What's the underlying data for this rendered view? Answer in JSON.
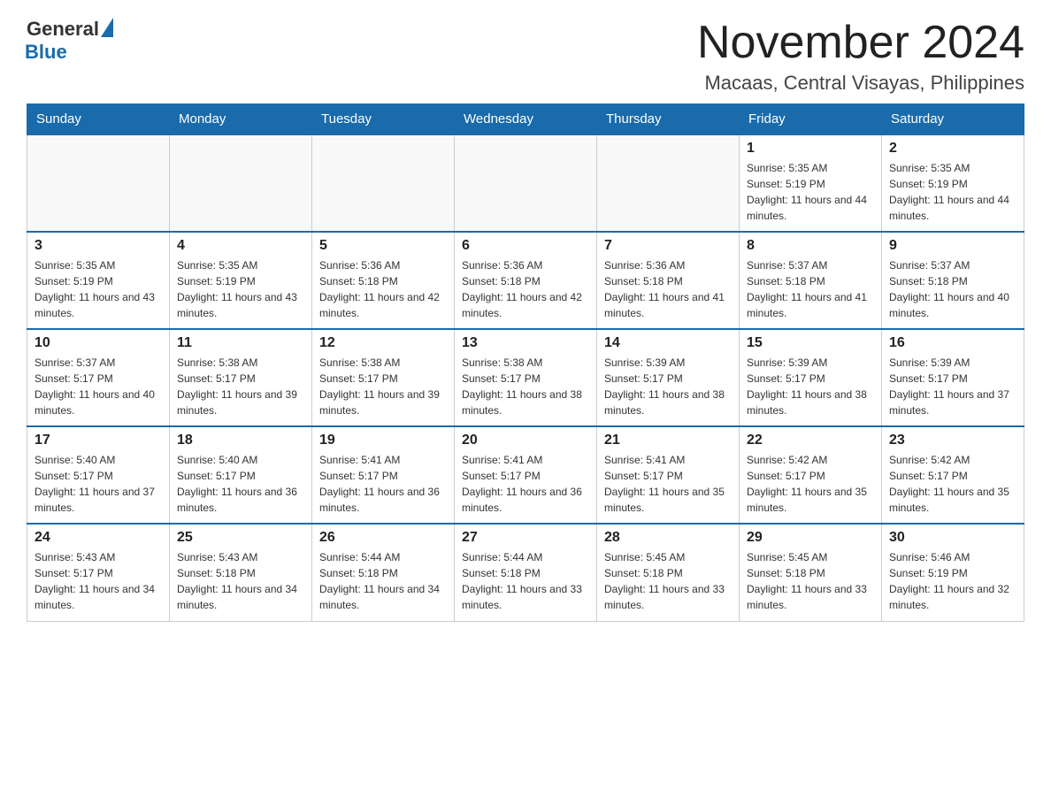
{
  "header": {
    "logo_general": "General",
    "logo_blue": "Blue",
    "month_title": "November 2024",
    "location": "Macaas, Central Visayas, Philippines"
  },
  "weekdays": [
    "Sunday",
    "Monday",
    "Tuesday",
    "Wednesday",
    "Thursday",
    "Friday",
    "Saturday"
  ],
  "weeks": [
    [
      {
        "day": "",
        "sunrise": "",
        "sunset": "",
        "daylight": ""
      },
      {
        "day": "",
        "sunrise": "",
        "sunset": "",
        "daylight": ""
      },
      {
        "day": "",
        "sunrise": "",
        "sunset": "",
        "daylight": ""
      },
      {
        "day": "",
        "sunrise": "",
        "sunset": "",
        "daylight": ""
      },
      {
        "day": "",
        "sunrise": "",
        "sunset": "",
        "daylight": ""
      },
      {
        "day": "1",
        "sunrise": "Sunrise: 5:35 AM",
        "sunset": "Sunset: 5:19 PM",
        "daylight": "Daylight: 11 hours and 44 minutes."
      },
      {
        "day": "2",
        "sunrise": "Sunrise: 5:35 AM",
        "sunset": "Sunset: 5:19 PM",
        "daylight": "Daylight: 11 hours and 44 minutes."
      }
    ],
    [
      {
        "day": "3",
        "sunrise": "Sunrise: 5:35 AM",
        "sunset": "Sunset: 5:19 PM",
        "daylight": "Daylight: 11 hours and 43 minutes."
      },
      {
        "day": "4",
        "sunrise": "Sunrise: 5:35 AM",
        "sunset": "Sunset: 5:19 PM",
        "daylight": "Daylight: 11 hours and 43 minutes."
      },
      {
        "day": "5",
        "sunrise": "Sunrise: 5:36 AM",
        "sunset": "Sunset: 5:18 PM",
        "daylight": "Daylight: 11 hours and 42 minutes."
      },
      {
        "day": "6",
        "sunrise": "Sunrise: 5:36 AM",
        "sunset": "Sunset: 5:18 PM",
        "daylight": "Daylight: 11 hours and 42 minutes."
      },
      {
        "day": "7",
        "sunrise": "Sunrise: 5:36 AM",
        "sunset": "Sunset: 5:18 PM",
        "daylight": "Daylight: 11 hours and 41 minutes."
      },
      {
        "day": "8",
        "sunrise": "Sunrise: 5:37 AM",
        "sunset": "Sunset: 5:18 PM",
        "daylight": "Daylight: 11 hours and 41 minutes."
      },
      {
        "day": "9",
        "sunrise": "Sunrise: 5:37 AM",
        "sunset": "Sunset: 5:18 PM",
        "daylight": "Daylight: 11 hours and 40 minutes."
      }
    ],
    [
      {
        "day": "10",
        "sunrise": "Sunrise: 5:37 AM",
        "sunset": "Sunset: 5:17 PM",
        "daylight": "Daylight: 11 hours and 40 minutes."
      },
      {
        "day": "11",
        "sunrise": "Sunrise: 5:38 AM",
        "sunset": "Sunset: 5:17 PM",
        "daylight": "Daylight: 11 hours and 39 minutes."
      },
      {
        "day": "12",
        "sunrise": "Sunrise: 5:38 AM",
        "sunset": "Sunset: 5:17 PM",
        "daylight": "Daylight: 11 hours and 39 minutes."
      },
      {
        "day": "13",
        "sunrise": "Sunrise: 5:38 AM",
        "sunset": "Sunset: 5:17 PM",
        "daylight": "Daylight: 11 hours and 38 minutes."
      },
      {
        "day": "14",
        "sunrise": "Sunrise: 5:39 AM",
        "sunset": "Sunset: 5:17 PM",
        "daylight": "Daylight: 11 hours and 38 minutes."
      },
      {
        "day": "15",
        "sunrise": "Sunrise: 5:39 AM",
        "sunset": "Sunset: 5:17 PM",
        "daylight": "Daylight: 11 hours and 38 minutes."
      },
      {
        "day": "16",
        "sunrise": "Sunrise: 5:39 AM",
        "sunset": "Sunset: 5:17 PM",
        "daylight": "Daylight: 11 hours and 37 minutes."
      }
    ],
    [
      {
        "day": "17",
        "sunrise": "Sunrise: 5:40 AM",
        "sunset": "Sunset: 5:17 PM",
        "daylight": "Daylight: 11 hours and 37 minutes."
      },
      {
        "day": "18",
        "sunrise": "Sunrise: 5:40 AM",
        "sunset": "Sunset: 5:17 PM",
        "daylight": "Daylight: 11 hours and 36 minutes."
      },
      {
        "day": "19",
        "sunrise": "Sunrise: 5:41 AM",
        "sunset": "Sunset: 5:17 PM",
        "daylight": "Daylight: 11 hours and 36 minutes."
      },
      {
        "day": "20",
        "sunrise": "Sunrise: 5:41 AM",
        "sunset": "Sunset: 5:17 PM",
        "daylight": "Daylight: 11 hours and 36 minutes."
      },
      {
        "day": "21",
        "sunrise": "Sunrise: 5:41 AM",
        "sunset": "Sunset: 5:17 PM",
        "daylight": "Daylight: 11 hours and 35 minutes."
      },
      {
        "day": "22",
        "sunrise": "Sunrise: 5:42 AM",
        "sunset": "Sunset: 5:17 PM",
        "daylight": "Daylight: 11 hours and 35 minutes."
      },
      {
        "day": "23",
        "sunrise": "Sunrise: 5:42 AM",
        "sunset": "Sunset: 5:17 PM",
        "daylight": "Daylight: 11 hours and 35 minutes."
      }
    ],
    [
      {
        "day": "24",
        "sunrise": "Sunrise: 5:43 AM",
        "sunset": "Sunset: 5:17 PM",
        "daylight": "Daylight: 11 hours and 34 minutes."
      },
      {
        "day": "25",
        "sunrise": "Sunrise: 5:43 AM",
        "sunset": "Sunset: 5:18 PM",
        "daylight": "Daylight: 11 hours and 34 minutes."
      },
      {
        "day": "26",
        "sunrise": "Sunrise: 5:44 AM",
        "sunset": "Sunset: 5:18 PM",
        "daylight": "Daylight: 11 hours and 34 minutes."
      },
      {
        "day": "27",
        "sunrise": "Sunrise: 5:44 AM",
        "sunset": "Sunset: 5:18 PM",
        "daylight": "Daylight: 11 hours and 33 minutes."
      },
      {
        "day": "28",
        "sunrise": "Sunrise: 5:45 AM",
        "sunset": "Sunset: 5:18 PM",
        "daylight": "Daylight: 11 hours and 33 minutes."
      },
      {
        "day": "29",
        "sunrise": "Sunrise: 5:45 AM",
        "sunset": "Sunset: 5:18 PM",
        "daylight": "Daylight: 11 hours and 33 minutes."
      },
      {
        "day": "30",
        "sunrise": "Sunrise: 5:46 AM",
        "sunset": "Sunset: 5:19 PM",
        "daylight": "Daylight: 11 hours and 32 minutes."
      }
    ]
  ]
}
